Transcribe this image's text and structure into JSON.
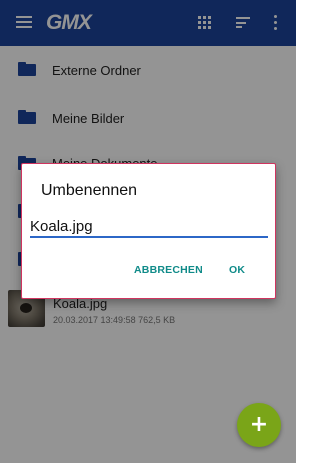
{
  "appbar": {
    "logo": "GMX",
    "icons": [
      "menu-icon",
      "grid-view-icon",
      "sort-icon",
      "more-vertical-icon"
    ],
    "color": "#1c449b"
  },
  "folders": [
    {
      "label": "Externe Ordner"
    },
    {
      "label": "Meine Bilder"
    },
    {
      "label": "Meine Dokumente"
    },
    {
      "label": ""
    },
    {
      "label": ""
    }
  ],
  "file": {
    "name": "Koala.jpg",
    "meta": "20.03.2017 13:49:58 762,5 KB"
  },
  "dialog": {
    "title": "Umbenennen",
    "input_value": "Koala.jpg",
    "cancel_label": "ABBRECHEN",
    "ok_label": "OK",
    "accent": "#108b89"
  },
  "fab": {
    "symbol": "+",
    "color": "#7aa518"
  }
}
